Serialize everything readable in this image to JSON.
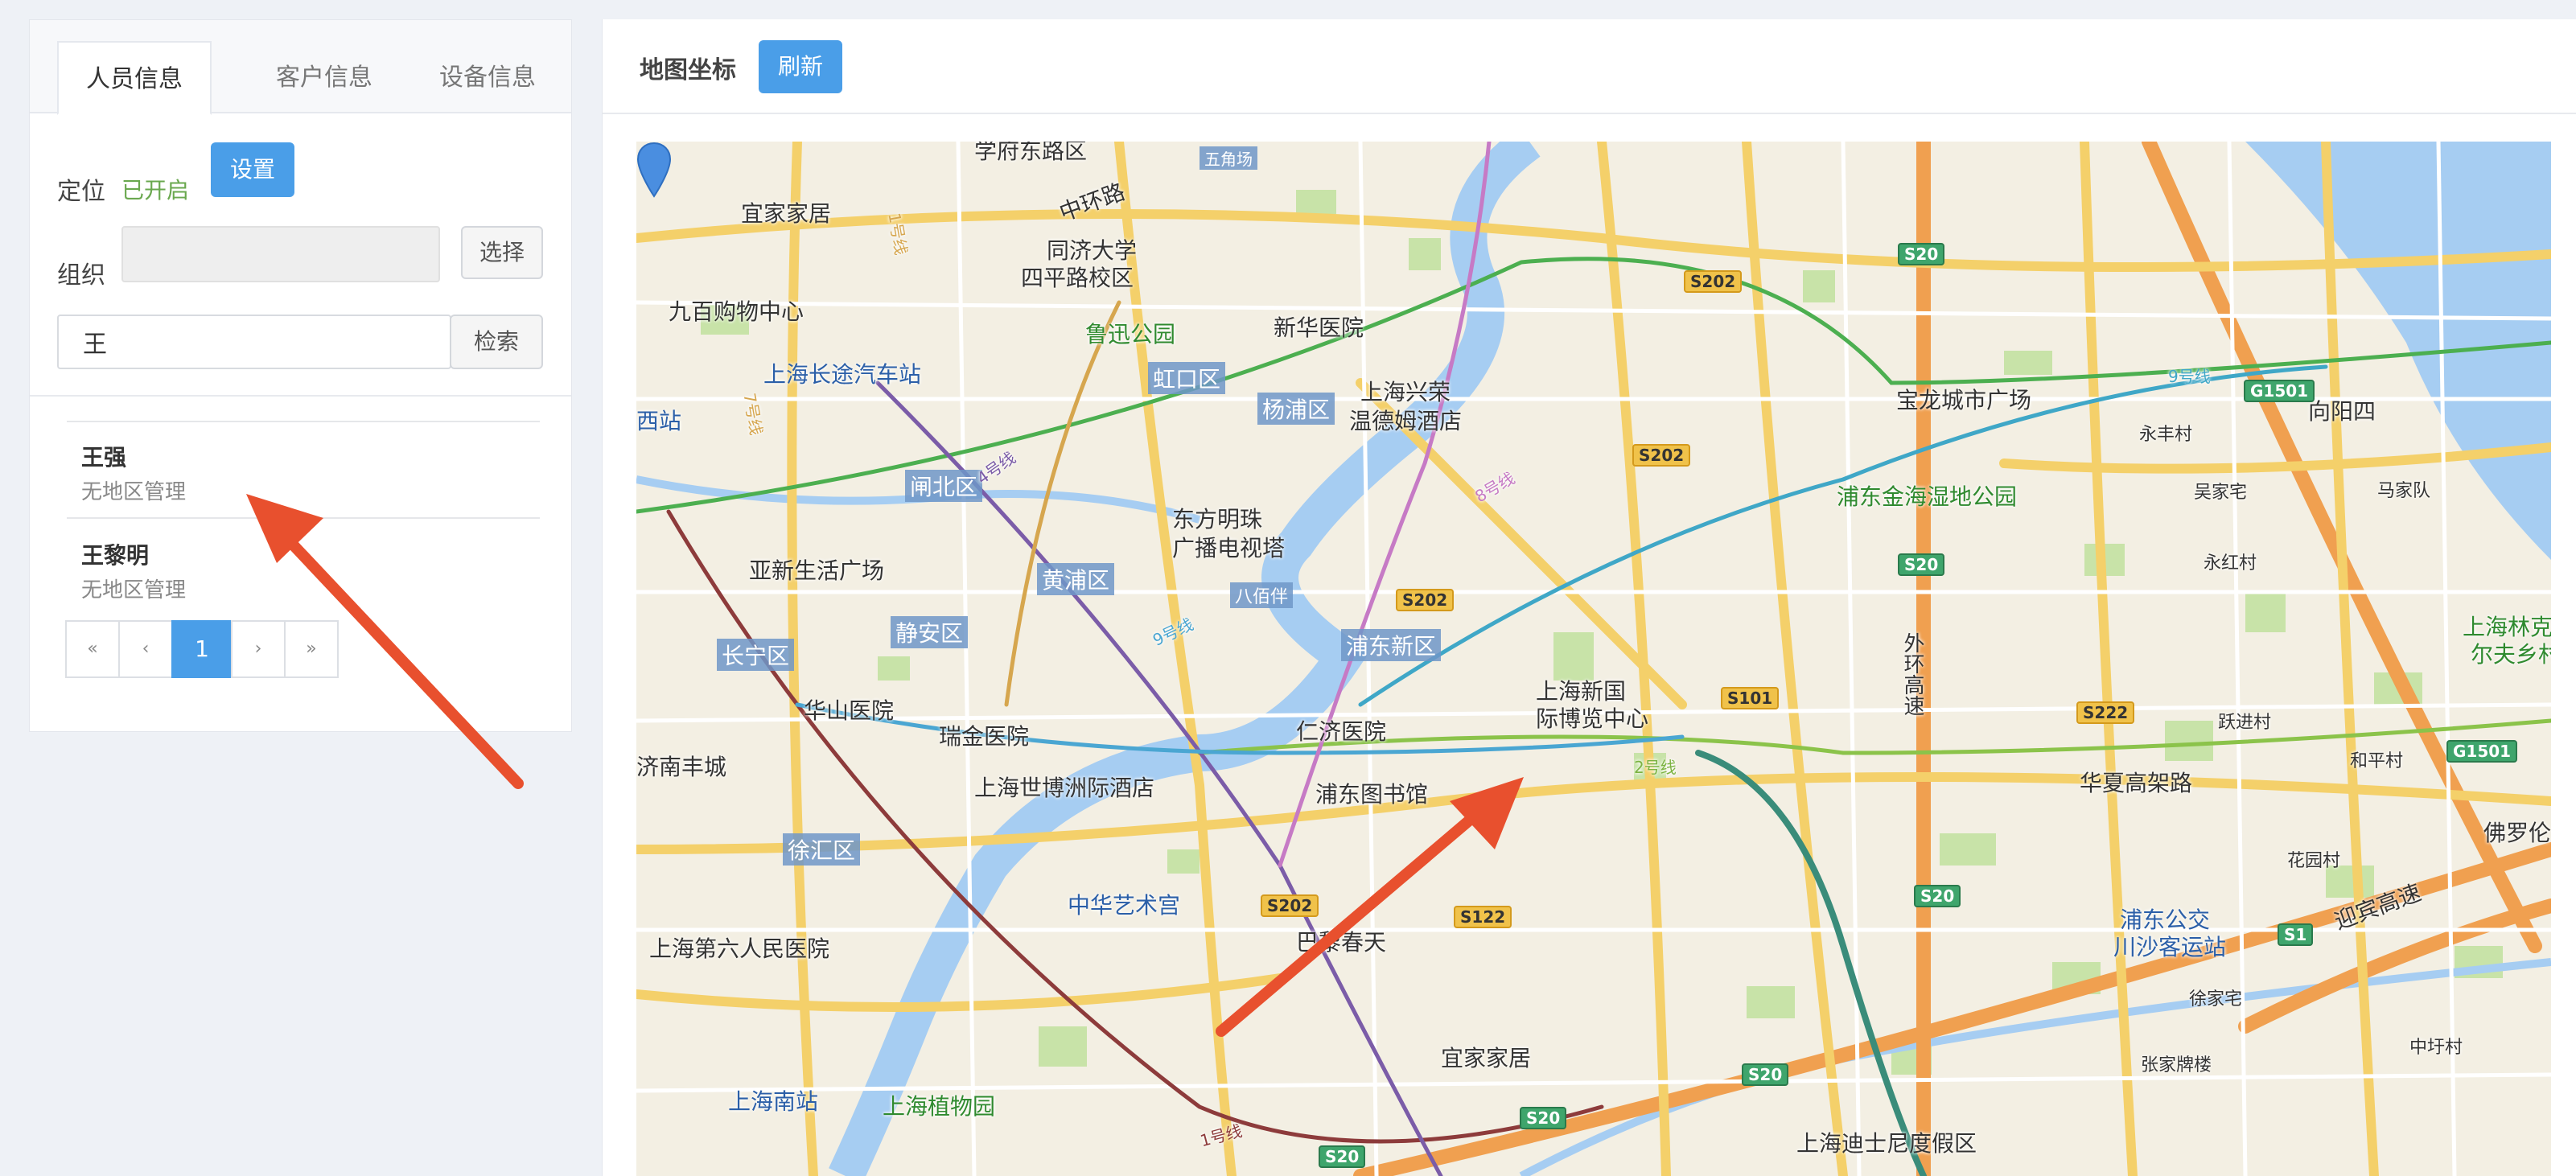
{
  "tabs": [
    "人员信息",
    "客户信息",
    "设备信息"
  ],
  "location": {
    "label": "定位",
    "status": "已开启",
    "settings_button": "设置"
  },
  "org": {
    "label": "组织",
    "select_button": "选择"
  },
  "search": {
    "value": "王",
    "button": "检索"
  },
  "people": [
    {
      "name": "王强",
      "region": "无地区管理"
    },
    {
      "name": "王黎明",
      "region": "无地区管理"
    }
  ],
  "pagination": {
    "first": "«",
    "prev": "‹",
    "current": "1",
    "next": "›",
    "last": "»"
  },
  "map_panel": {
    "title": "地图坐标",
    "refresh_button": "刷新"
  },
  "map": {
    "labels": {
      "l1": "宜家家居",
      "l2": "九百购物中心",
      "l3": "同济大学",
      "l4": "四平路校区",
      "l5": "鲁迅公园",
      "l6": "新华医院",
      "l7": "上海长途汽车站",
      "l8": "上海兴荣",
      "l9": "温德姆酒店",
      "l10": "东方明珠",
      "l11": "广播电视塔",
      "l12": "亚新生活广场",
      "l13": "华山医院",
      "l14": "瑞金医院",
      "l15": "仁济医院",
      "l16": "上海新国",
      "l17": "际博览中心",
      "l18": "上海世博洲际酒店",
      "l19": "浦东图书馆",
      "l20": "中华艺术宫",
      "l21": "上海第六人民医院",
      "l22": "巴黎春天",
      "l23": "宜家家居",
      "l24": "上海南站",
      "l25": "上海植物园",
      "l26": "上海迪士尼度假区",
      "l27": "宝龙城市广场",
      "l28": "浦东金海湿地公园",
      "l29": "浦东公交",
      "l30": "川沙客运站",
      "l31": "华夏高架路",
      "l32": "向阳四",
      "l33": "马家队",
      "l34": "永丰村",
      "l35": "吴家宅",
      "l36": "永红村",
      "l37": "上海林克",
      "l38": "尔夫乡村",
      "l39": "跃进村",
      "l40": "和平村",
      "l41": "花园村",
      "l42": "徐家宅",
      "l43": "张家牌楼",
      "l44": "中圩村",
      "l45": "佛罗伦",
      "l46": "济南丰城",
      "l47": "西站",
      "l48": "中环路",
      "l49": "学府东路区",
      "l50": "迎宾高速"
    },
    "districts": {
      "d1": "虹口区",
      "d2": "杨浦区",
      "d3": "闸北区",
      "d4": "黄浦区",
      "d5": "静安区",
      "d6": "长宁区",
      "d7": "浦东新区",
      "d8": "徐汇区",
      "d9": "五角场",
      "d10": "八佰伴"
    },
    "shields": {
      "s1": "S202",
      "s2": "S202",
      "s3": "S202",
      "s4": "S20",
      "s5": "S20",
      "s6": "S101",
      "s7": "S222",
      "s8": "S202",
      "s9": "S122",
      "s10": "S20",
      "s11": "S20",
      "s12": "S20",
      "s13": "S1",
      "s14": "G1501",
      "s15": "G1501",
      "s16": "S20"
    },
    "lines": {
      "m1": "9号线",
      "m2": "2号线",
      "m3": "1号线",
      "m4": "4号线",
      "m5": "8号线",
      "m6": "9号线",
      "m7": "7号线",
      "m8": "1号线",
      "m9": "外环高速"
    }
  }
}
